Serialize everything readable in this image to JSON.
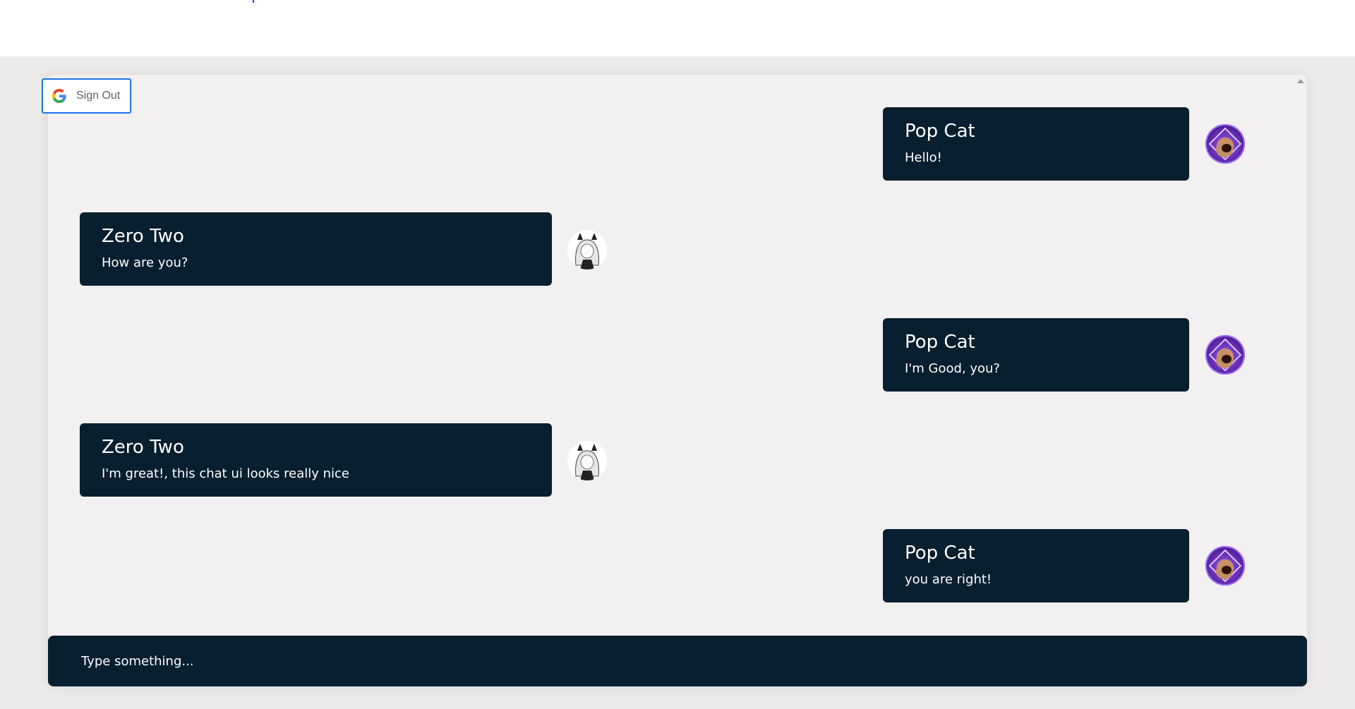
{
  "auth": {
    "signout_label": "Sign Out"
  },
  "messages": [
    {
      "sender": "Pop Cat",
      "text": "Hello!",
      "side": "right",
      "avatar": "pop-cat-avatar"
    },
    {
      "sender": "Zero Two",
      "text": "How are you?",
      "side": "left",
      "avatar": "zero-two-avatar"
    },
    {
      "sender": "Pop Cat",
      "text": "I'm Good, you?",
      "side": "right",
      "avatar": "pop-cat-avatar"
    },
    {
      "sender": "Zero Two",
      "text": "I'm great!, this chat ui looks really nice",
      "side": "left",
      "avatar": "zero-two-avatar"
    },
    {
      "sender": "Pop Cat",
      "text": "you are right!",
      "side": "right",
      "avatar": "pop-cat-avatar"
    }
  ],
  "composer": {
    "placeholder": "Type something..."
  },
  "colors": {
    "bubble": "#071f2f",
    "chat_background": "#f2f0f1",
    "page_background": "#ece9e9",
    "signout_border": "#1a73e8"
  },
  "icons": {
    "signout": "google-g-icon"
  }
}
